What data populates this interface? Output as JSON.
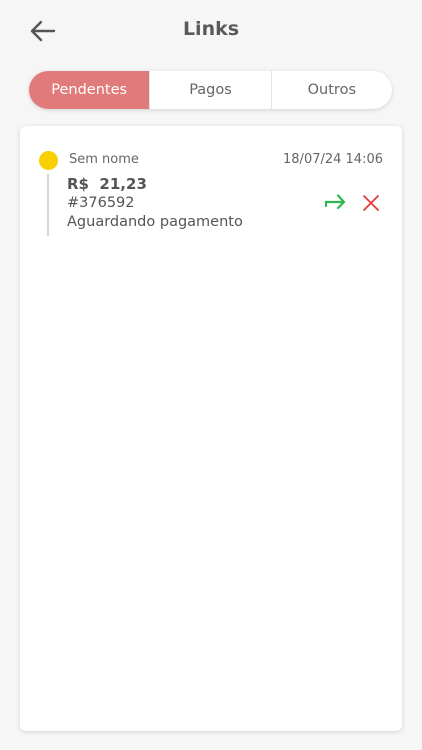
{
  "header": {
    "title": "Links",
    "back_icon": "arrow-left-icon"
  },
  "tabs": [
    {
      "label": "Pendentes",
      "active": true
    },
    {
      "label": "Pagos",
      "active": false
    },
    {
      "label": "Outros",
      "active": false
    }
  ],
  "links": [
    {
      "name": "Sem nome",
      "date": "18/07/24 14:06",
      "amount": "R$  21,23",
      "code": "#376592",
      "status": "Aguardando pagamento",
      "status_color": "#f6d000",
      "actions": [
        "share-arrow-icon",
        "close-icon"
      ]
    }
  ],
  "colors": {
    "accent": "#e07a7b",
    "pending": "#f6d000",
    "share": "#2eb84f",
    "cancel": "#e23a3a"
  }
}
